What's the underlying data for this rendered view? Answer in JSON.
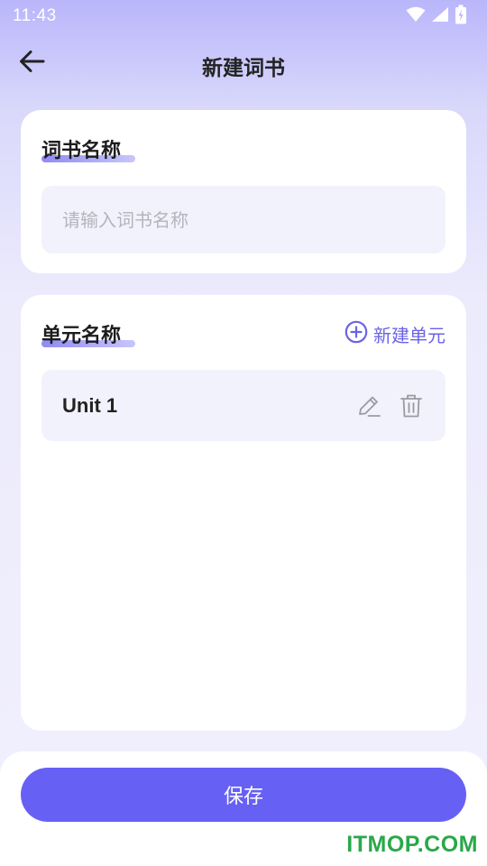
{
  "status_bar": {
    "time": "11:43",
    "icons": [
      "wifi-icon",
      "signal-icon",
      "battery-charging-icon"
    ]
  },
  "header": {
    "title": "新建词书",
    "back_icon": "arrow-left-icon"
  },
  "book_section": {
    "title": "词书名称",
    "input_placeholder": "请输入词书名称",
    "input_value": ""
  },
  "units_section": {
    "title": "单元名称",
    "new_unit_label": "新建单元",
    "new_unit_icon": "plus-circle-icon",
    "units": [
      {
        "name": "Unit 1",
        "edit_icon": "pencil-icon",
        "delete_icon": "trash-icon"
      }
    ]
  },
  "footer": {
    "save_label": "保存"
  },
  "watermark": "ITMOP.COM",
  "colors": {
    "accent": "#6760f4",
    "accent_text": "#6a63e6",
    "input_bg": "#f2f2fc",
    "header_gradient_top": "#b9b6fb",
    "watermark": "#2aa84a"
  }
}
